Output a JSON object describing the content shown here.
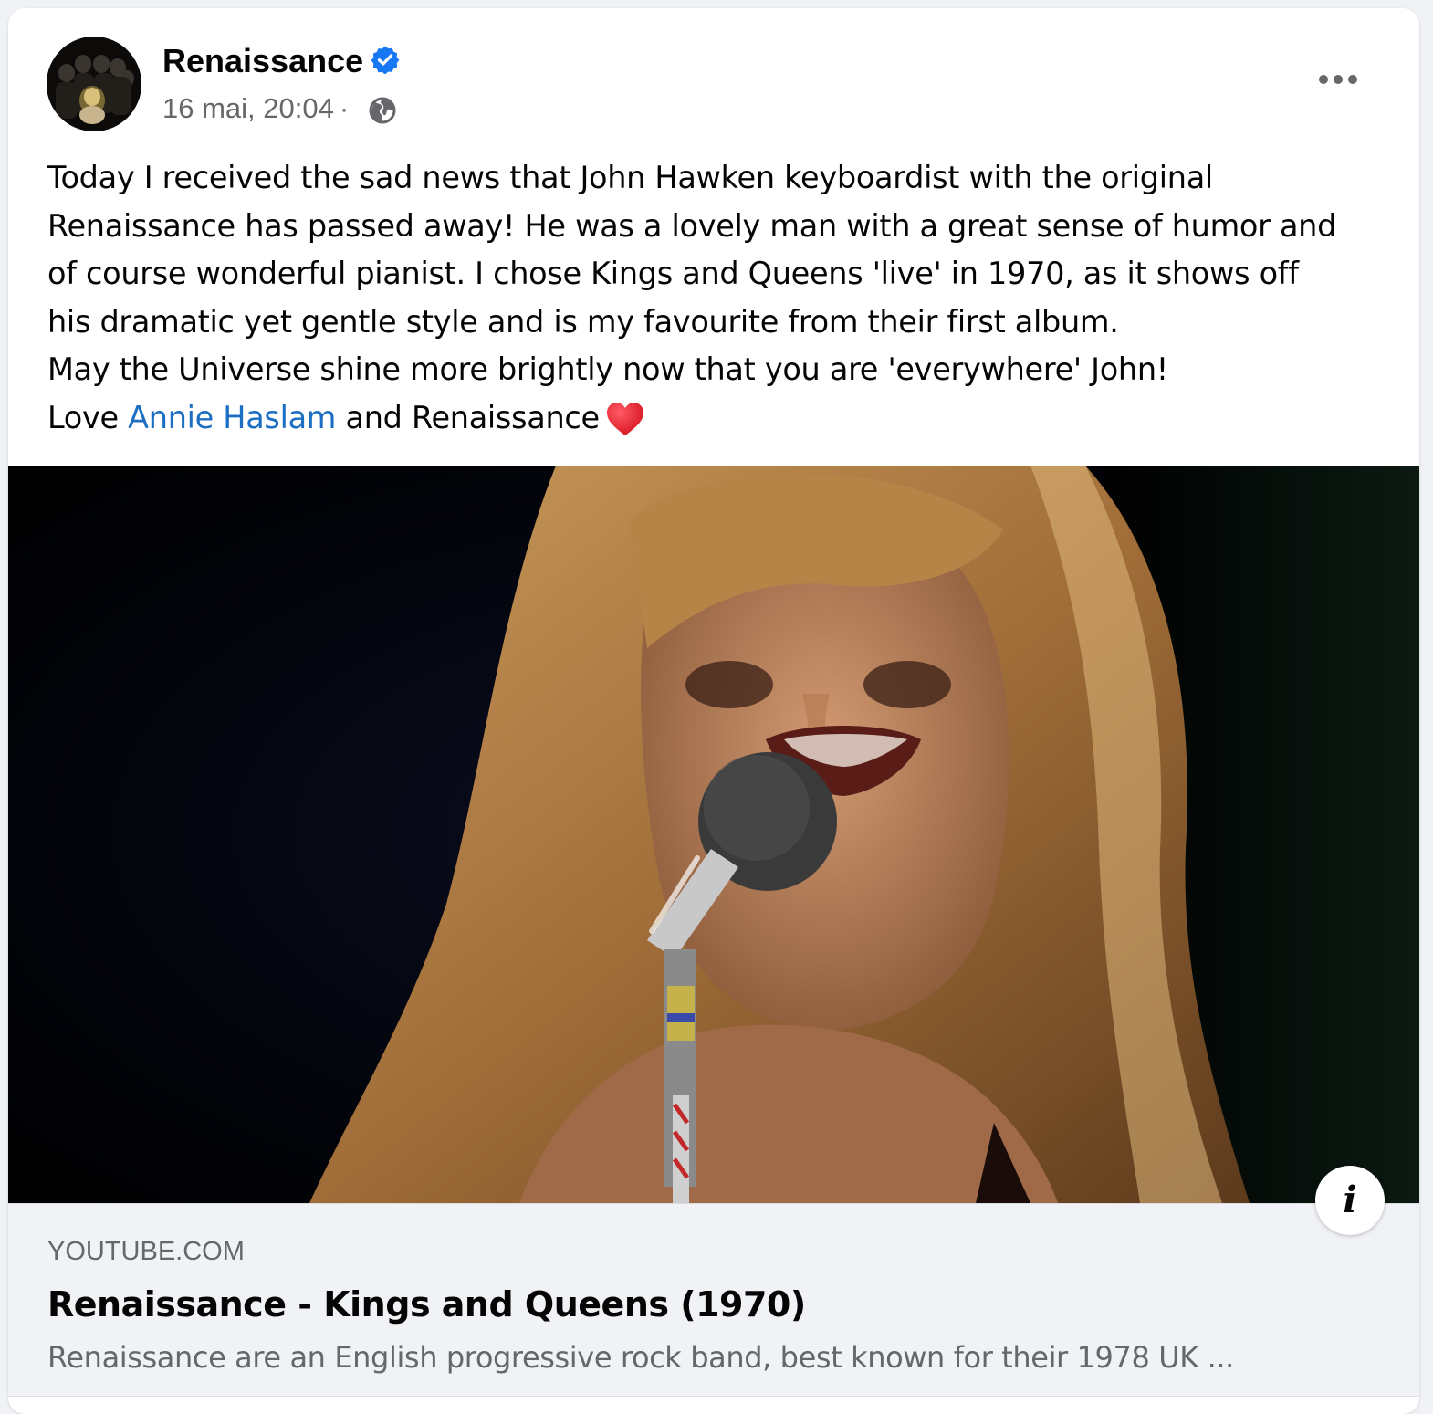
{
  "post": {
    "page_name": "Renaissance",
    "verified": true,
    "timestamp": "16 mai, 20:04",
    "separator": "·",
    "audience_icon": "globe-icon",
    "more_icon": "more-horizontal-icon",
    "avatar_alt": "Renaissance",
    "message": {
      "lines": [
        "Today I received the sad news that John Hawken keyboardist with the original",
        "Renaissance has passed away! He was a lovely man with a great sense of humor and",
        "of course wonderful pianist. I chose Kings and Queens 'live' in 1970, as it shows off",
        "his dramatic yet gentle style and is my favourite from their first album.",
        "May the Universe shine more brightly now that you are 'everywhere' John!"
      ],
      "last_line": {
        "prefix": "Love ",
        "mention": "Annie Haslam",
        "suffix": " and Renaissance",
        "emoji": "heart-icon"
      }
    },
    "colors": {
      "mention": "#1b6ec2",
      "verified": "#1877f2",
      "secondary_text": "#65676b",
      "link_box_bg": "#f0f2f5"
    }
  },
  "link_preview": {
    "domain": "YOUTUBE.COM",
    "title": "Renaissance - Kings and Queens (1970)",
    "description": "Renaissance are an English progressive rock band, best known for their 1978 UK ...",
    "info_icon": "info-icon"
  }
}
